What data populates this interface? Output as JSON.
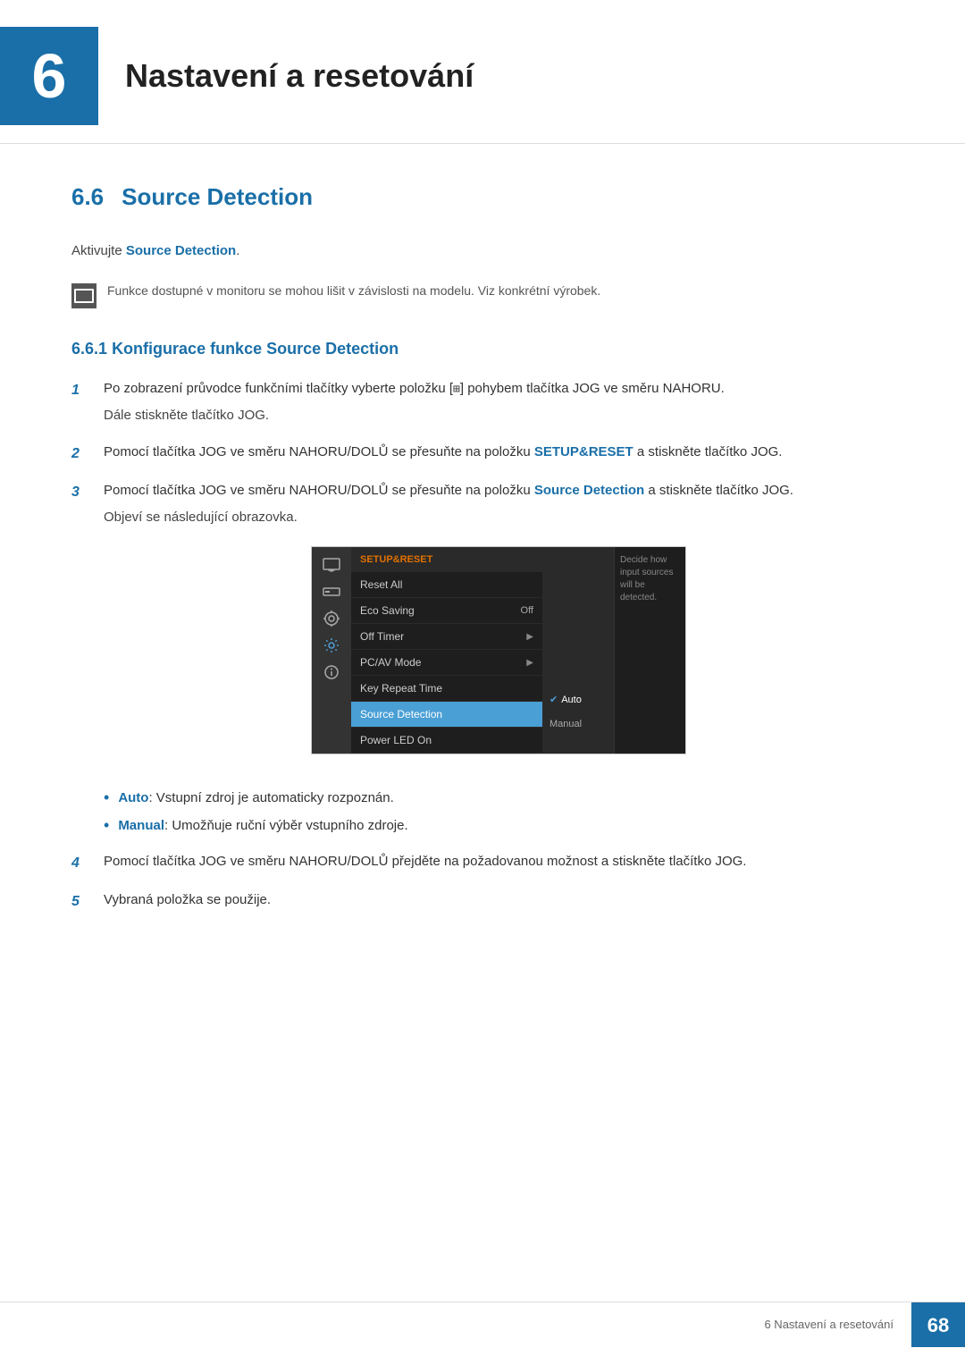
{
  "chapter": {
    "number": "6",
    "title": "Nastavení a resetování"
  },
  "section": {
    "number": "6.6",
    "title": "Source Detection"
  },
  "activate_line": "Aktivujte ",
  "activate_bold": "Source Detection",
  "note_text": "Funkce dostupné v monitoru se mohou lišit v závislosti na modelu. Viz konkrétní výrobek.",
  "subsection": {
    "number": "6.6.1",
    "title": "Konfigurace funkce Source Detection"
  },
  "steps": [
    {
      "number": "1",
      "text": "Po zobrazení průvodce funkčními tlačítky vyberte položku [",
      "text_mid": "⊞",
      "text_end": "] pohybem tlačítka JOG ve směru NAHORU.",
      "sub": "Dále stiskněte tlačítko JOG."
    },
    {
      "number": "2",
      "text": "Pomocí tlačítka JOG ve směru NAHORU/DOLŮ se přesuňte na položku ",
      "bold": "SETUP&RESET",
      "text_end": " a stiskněte tlačítko JOG.",
      "sub": ""
    },
    {
      "number": "3",
      "text": "Pomocí tlačítka JOG ve směru NAHORU/DOLŮ se přesuňte na položku ",
      "bold": "Source Detection",
      "text_end": " a stiskněte tlačítko JOG.",
      "sub": "Objeví se následující obrazovka."
    },
    {
      "number": "4",
      "text": "Pomocí tlačítka JOG ve směru NAHORU/DOLŮ přejděte na požadovanou možnost a stiskněte tlačítko JOG.",
      "sub": ""
    },
    {
      "number": "5",
      "text": "Vybraná položka se použije.",
      "sub": ""
    }
  ],
  "menu": {
    "header": "SETUP&RESET",
    "items": [
      {
        "label": "Reset All",
        "value": "",
        "arrow": false,
        "highlighted": false
      },
      {
        "label": "Eco Saving",
        "value": "Off",
        "arrow": false,
        "highlighted": false
      },
      {
        "label": "Off Timer",
        "value": "",
        "arrow": true,
        "highlighted": false
      },
      {
        "label": "PC/AV Mode",
        "value": "",
        "arrow": true,
        "highlighted": false
      },
      {
        "label": "Key Repeat Time",
        "value": "",
        "arrow": false,
        "highlighted": false
      },
      {
        "label": "Source Detection",
        "value": "",
        "arrow": false,
        "highlighted": true
      },
      {
        "label": "Power LED On",
        "value": "",
        "arrow": false,
        "highlighted": false
      }
    ],
    "submenu": [
      {
        "label": "✔ Auto",
        "active": true
      },
      {
        "label": "Manual",
        "active": false
      }
    ],
    "hint": "Decide how input sources will be detected."
  },
  "bullets": [
    {
      "label": "Auto",
      "text": ": Vstupní zdroj je automaticky rozpoznán."
    },
    {
      "label": "Manual",
      "text": ": Umožňuje ruční výběr vstupního zdroje."
    }
  ],
  "footer": {
    "text": "6 Nastavení a resetování",
    "page": "68"
  }
}
